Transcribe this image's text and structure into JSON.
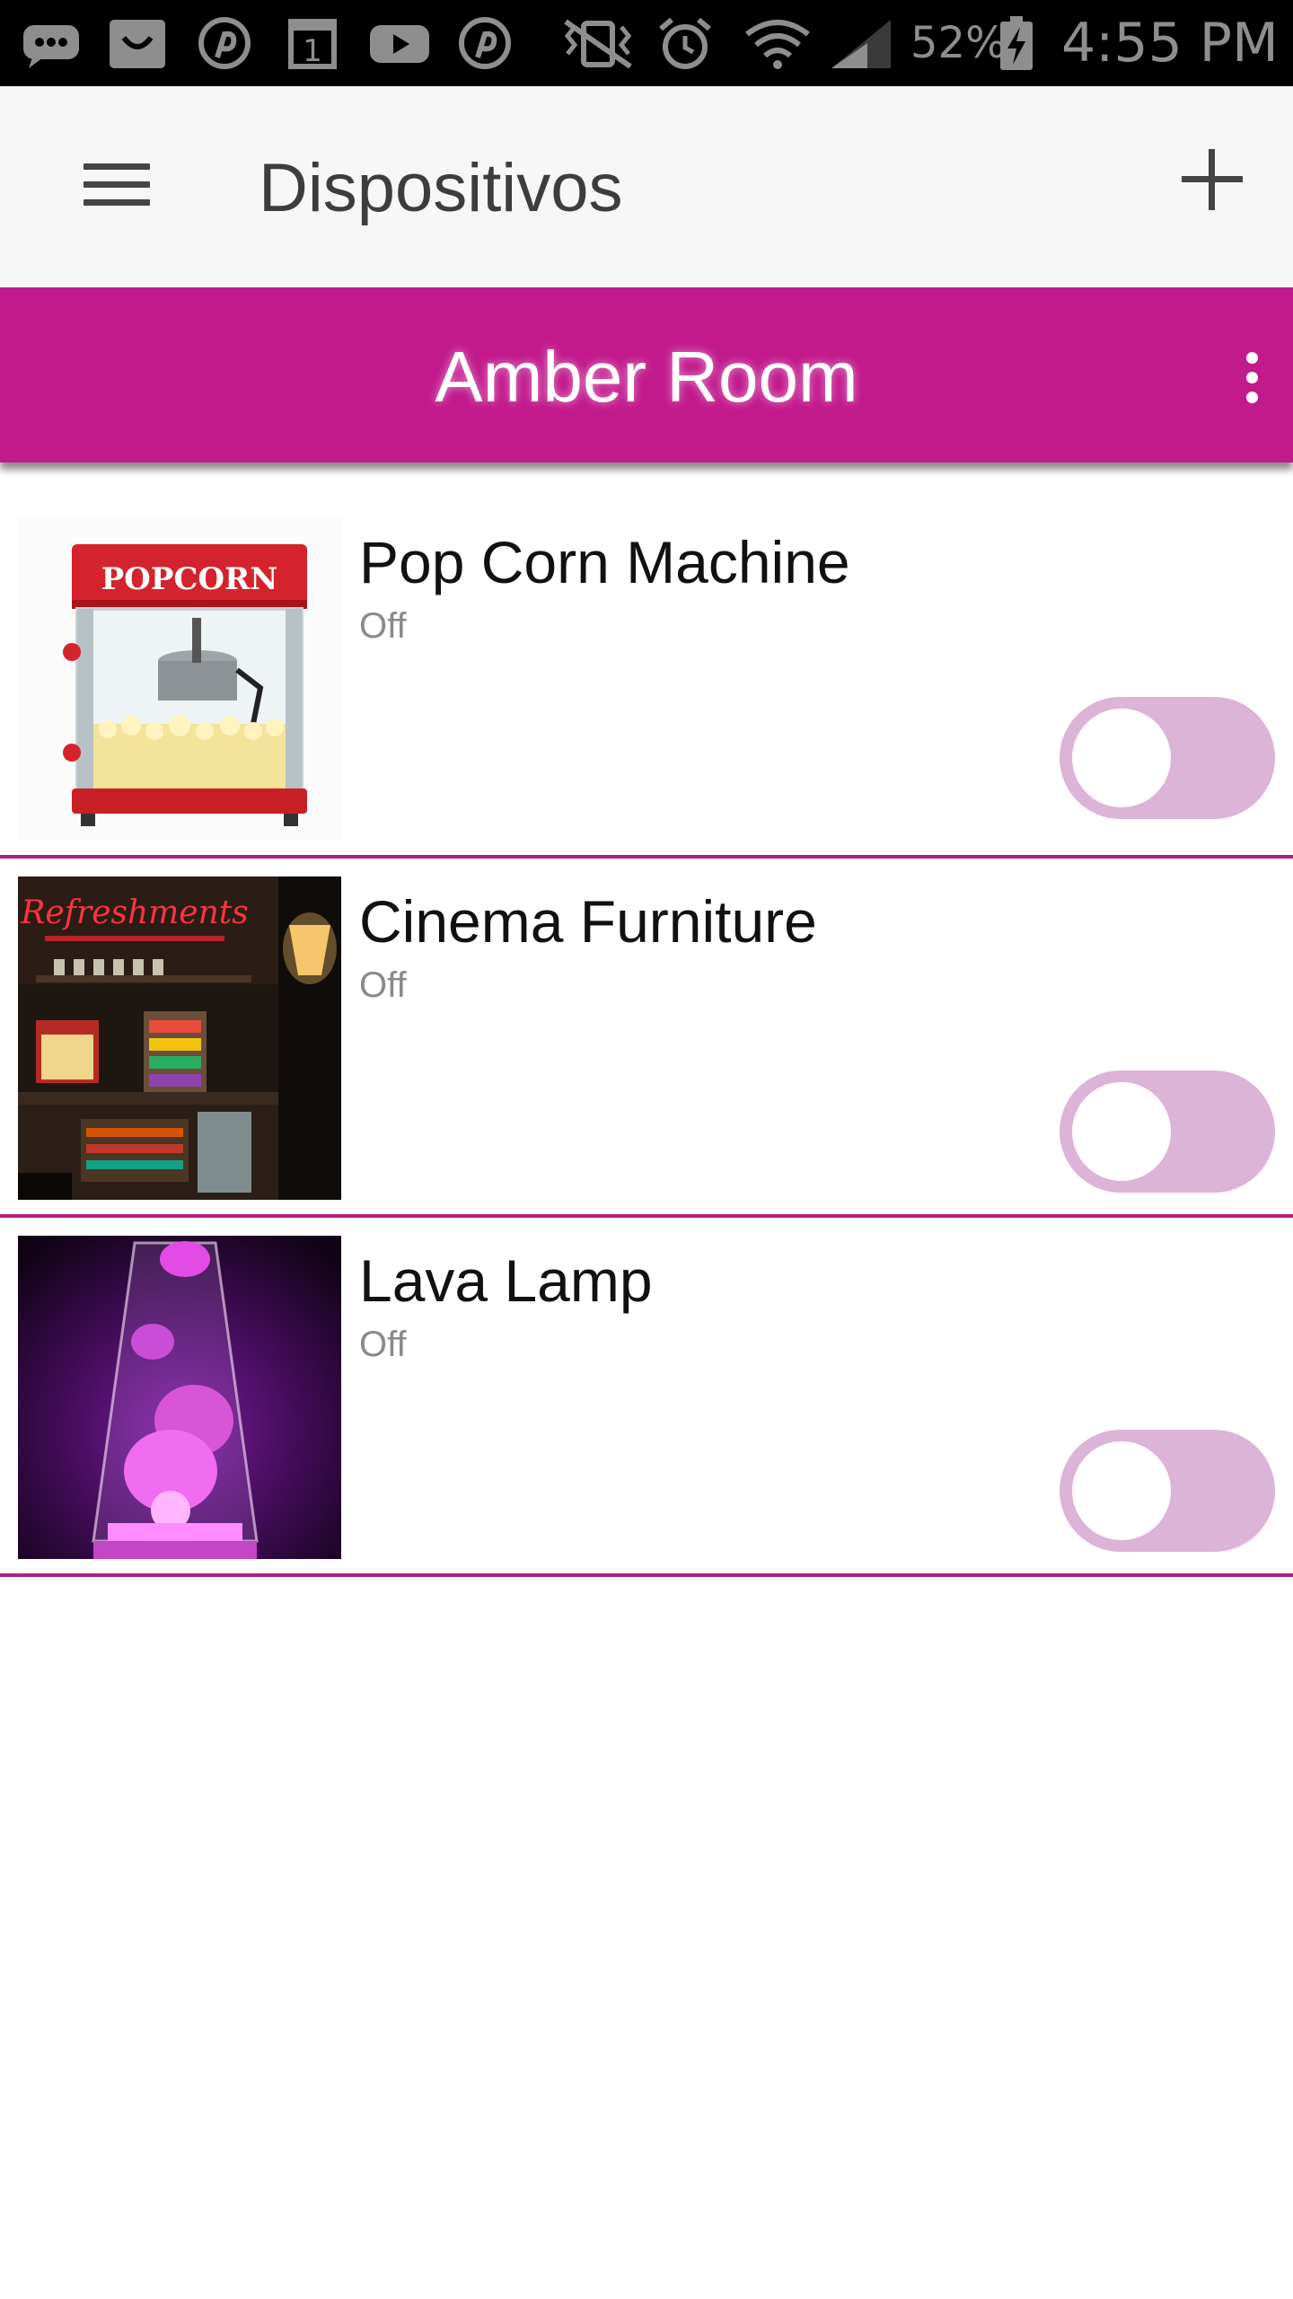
{
  "status_bar": {
    "battery_percent": "52%",
    "time": "4:55 PM",
    "calendar_day": "1",
    "icons": [
      "chat-icon",
      "shopping-bag-icon",
      "pinterest-icon",
      "calendar-icon",
      "youtube-icon",
      "pinterest-icon",
      "vibrate-mute-icon",
      "alarm-icon",
      "wifi-icon",
      "cellular-signal-icon",
      "battery-charging-icon"
    ]
  },
  "app_bar": {
    "title": "Dispositivos",
    "menu_icon": "hamburger-menu-icon",
    "add_icon": "plus-icon"
  },
  "room": {
    "name": "Amber Room",
    "accent_color": "#c21a8c",
    "overflow_icon": "more-vertical-icon"
  },
  "devices": [
    {
      "name": "Pop Corn Machine",
      "status": "Off",
      "on": false,
      "image": "popcorn-machine-image",
      "image_text": "POPCORN"
    },
    {
      "name": "Cinema Furniture",
      "status": "Off",
      "on": false,
      "image": "cinema-refreshment-bar-image",
      "image_text": "Refreshments"
    },
    {
      "name": "Lava Lamp",
      "status": "Off",
      "on": false,
      "image": "lava-lamp-image"
    }
  ]
}
